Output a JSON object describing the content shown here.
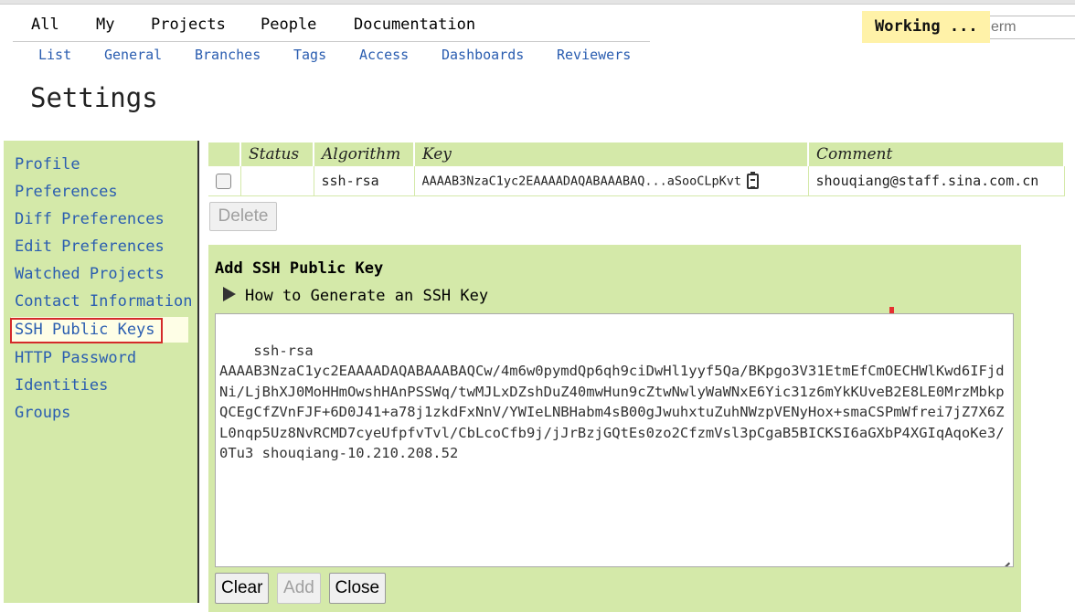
{
  "top_menu": [
    "All",
    "My",
    "Projects",
    "People",
    "Documentation"
  ],
  "sub_menu": [
    "List",
    "General",
    "Branches",
    "Tags",
    "Access",
    "Dashboards",
    "Reviewers"
  ],
  "status": "Working ...",
  "search": {
    "placeholder": "erm"
  },
  "page_title": "Settings",
  "sidebar": {
    "items": [
      {
        "label": "Profile"
      },
      {
        "label": "Preferences"
      },
      {
        "label": "Diff Preferences"
      },
      {
        "label": "Edit Preferences"
      },
      {
        "label": "Watched Projects"
      },
      {
        "label": "Contact Information"
      },
      {
        "label": "SSH Public Keys"
      },
      {
        "label": "HTTP Password"
      },
      {
        "label": "Identities"
      },
      {
        "label": "Groups"
      }
    ],
    "selected": "SSH Public Keys"
  },
  "key_table": {
    "headers": [
      "",
      "Status",
      "Algorithm",
      "Key",
      "Comment"
    ],
    "rows": [
      {
        "status": "",
        "algorithm": "ssh-rsa",
        "key": "AAAAB3NzaC1yc2EAAAADAQABAAABAQ...aSooCLpKvt",
        "comment": "shouqiang@staff.sina.com.cn"
      }
    ]
  },
  "delete_label": "Delete",
  "add_panel": {
    "title": "Add SSH Public Key",
    "disclosure": "How to Generate an SSH Key",
    "key_value": "ssh-rsa\nAAAAB3NzaC1yc2EAAAADAQABAAABAQCw/4m6w0pymdQp6qh9ciDwHl1yyf5Qa/BKpgo3V31EtmEfCmOECHWlKwd6IFjdNi/LjBhXJ0MoHHmOwshHAnPSSWq/twMJLxDZshDuZ40mwHun9cZtwNwlyWaWNxE6Yic31z6mYkKUveB2E8LE0MrzMbkpQCEgCfZVnFJF+6D0J41+a78j1zkdFxNnV/YWIeLNBHabm4sB00gJwuhxtuZuhNWzpVENyHox+smaCSPmWfrei7jZ7X6ZL0nqp5Uz8NvRCMD7cyeUfpfvTvl/CbLcoCfb9j/jJrBzjGQtEs0zo2CfzmVsl3pCgaB5BICKSI6aGXbP4XGIqAqoKe3/0Tu3 shouqiang-10.210.208.52",
    "buttons": {
      "clear": "Clear",
      "add": "Add",
      "close": "Close"
    }
  }
}
